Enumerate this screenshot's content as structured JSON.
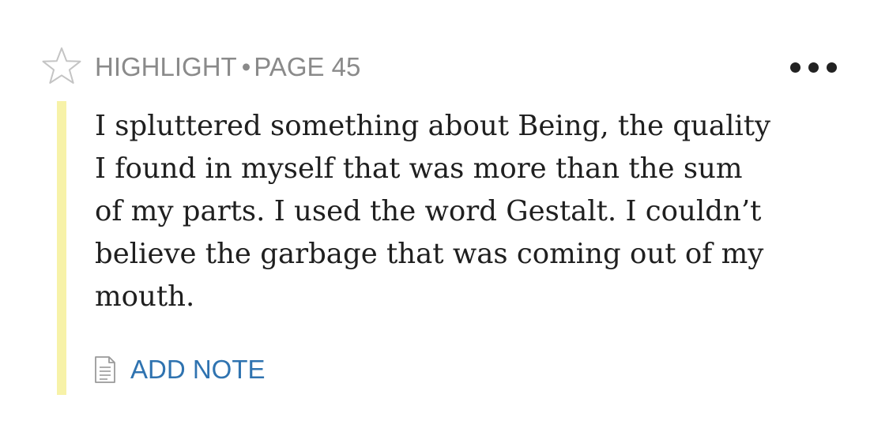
{
  "header": {
    "type_label": "HIGHLIGHT",
    "separator": "•",
    "page_label": "PAGE 45",
    "star_icon": "star-outline-icon",
    "more_icon": "more-horizontal-icon"
  },
  "highlight": {
    "color": "#f7f2a8",
    "lines": [
      "I spluttered something about Being, the quality",
      "I found in myself that was more than the sum",
      "of my parts. I used the word Gestalt. I couldn’t",
      "believe the garbage that was coming out of my",
      "mouth."
    ]
  },
  "actions": {
    "add_note_label": "ADD NOTE",
    "add_note_icon": "note-document-icon",
    "link_color": "#2f73b0"
  }
}
